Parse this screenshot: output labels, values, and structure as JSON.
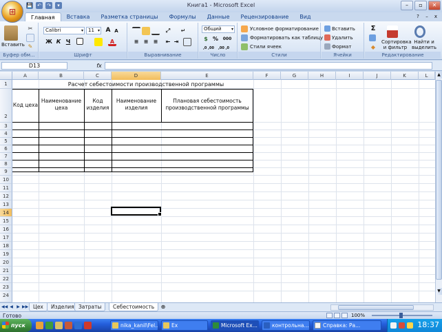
{
  "app": {
    "title": "Книга1 - Microsoft Excel",
    "office_button_glyph": "⊞",
    "qat": [
      "💾",
      "↶",
      "↷",
      "▾"
    ],
    "window_controls": [
      "–",
      "▫",
      "✕"
    ]
  },
  "ribbon": {
    "tabs": [
      "Главная",
      "Вставка",
      "Разметка страницы",
      "Формулы",
      "Данные",
      "Рецензирование",
      "Вид"
    ],
    "active_tab": "Главная",
    "help": [
      "?",
      "–",
      "x"
    ],
    "clipboard": {
      "paste_label": "Вставить",
      "group_label": "Буфер обм..."
    },
    "font": {
      "name": "Calibri",
      "size": "11",
      "grow": "A",
      "shrink": "A",
      "bold": "Ж",
      "italic": "К",
      "underline": "Ч",
      "group_label": "Шрифт"
    },
    "alignment": {
      "group_label": "Выравнивание"
    },
    "number": {
      "format": "Общий",
      "currency": "$",
      "percent": "%",
      "thousands": "000",
      "group_label": "Число",
      "dec_inc": ",0 ,00",
      "dec_dec": ",00 ,0"
    },
    "styles": {
      "conditional": "Условное форматирование",
      "as_table": "Форматировать как таблицу",
      "cell_styles": "Стили ячеек",
      "group_label": "Стили"
    },
    "cells": {
      "insert": "Вставить",
      "delete": "Удалить",
      "format": "Формат",
      "group_label": "Ячейки"
    },
    "editing": {
      "sum": "Σ",
      "sort_filter": "Сортировка и фильтр",
      "find_select": "Найти и выделить",
      "group_label": "Редактирование"
    }
  },
  "formula_bar": {
    "name_box": "D13",
    "fx": "fx",
    "value": ""
  },
  "grid": {
    "columns": [
      "A",
      "B",
      "C",
      "D",
      "E",
      "F",
      "G",
      "H",
      "I",
      "J",
      "K",
      "L"
    ],
    "rows": [
      "1",
      "2",
      "3",
      "4",
      "5",
      "6",
      "7",
      "8",
      "9",
      "10",
      "11",
      "12",
      "13",
      "14",
      "15",
      "16",
      "17",
      "18",
      "19",
      "20",
      "21",
      "22",
      "23",
      "24"
    ],
    "selected_col": "D",
    "selected_row": "14",
    "title": "Расчет себестоимости производственной программы",
    "headers": {
      "code": "Код цеха",
      "name_shop": "Наименование цеха",
      "code_item": "Код изделия",
      "name_item": "Наименование изделия",
      "plan_cost": "Плановая себестоимость производственной программы"
    }
  },
  "sheets": {
    "nav": [
      "◀◀",
      "◀",
      "▶",
      "▶▶"
    ],
    "tabs": [
      "Цех",
      "Изделия",
      "Затраты",
      "Себестоимость"
    ],
    "active": "Себестоимость",
    "new_sheet_icon": "⊕"
  },
  "status": {
    "text": "Готово",
    "zoom": "100%"
  },
  "taskbar": {
    "start": "пуск",
    "buttons": [
      "nika_kanil\\Fel...",
      "Ex",
      "Microsoft Ex...",
      "контрольна...",
      "Справка: Ра..."
    ],
    "active_button": "Microsoft Ex...",
    "clock": "18:37"
  }
}
